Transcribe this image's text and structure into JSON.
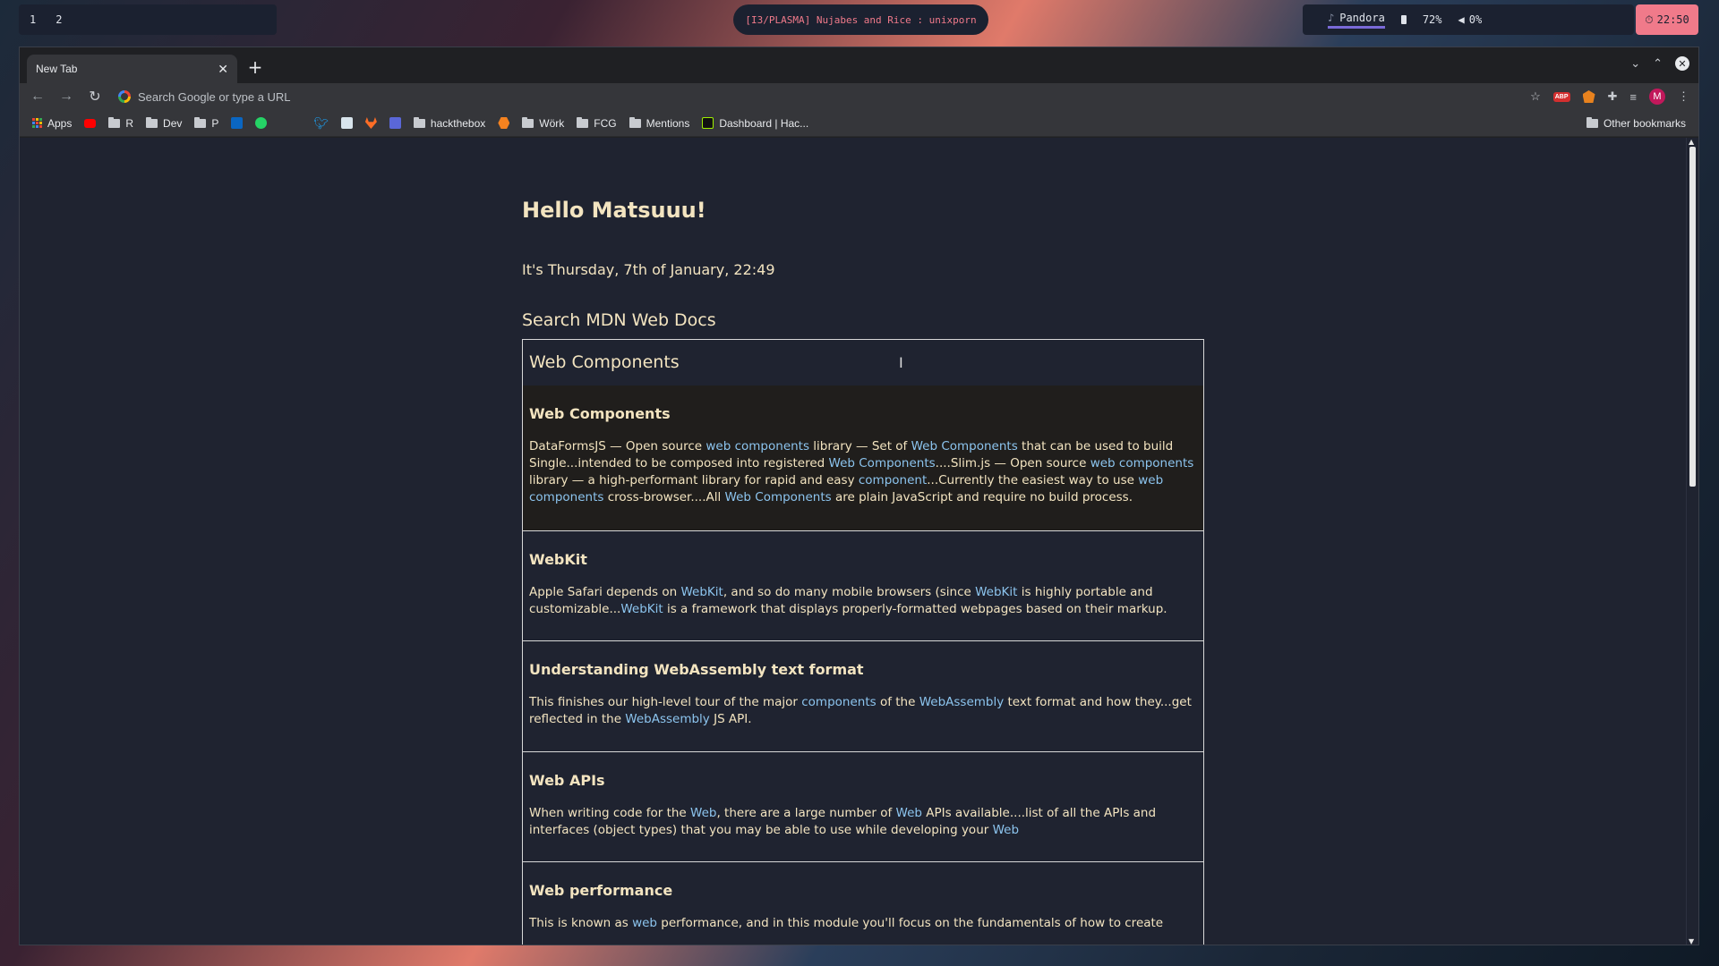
{
  "topbar": {
    "workspaces": [
      "1",
      "2"
    ],
    "window_title": "[I3/PLASMA] Nujabes and Rice : unixporn",
    "music_label": "Pandora",
    "battery": "72%",
    "volume": "0%",
    "clock": "22:50",
    "colors": {
      "bar_bg": "#1b2130",
      "accent": "#f07a8a",
      "music_underline": "#7a6ad8"
    }
  },
  "browser": {
    "tab_label": "New Tab",
    "omnibox_placeholder": "Search Google or type a URL",
    "avatar_letter": "M",
    "bookmarks": [
      {
        "label": "Apps",
        "icon": "apps-grid-icon"
      },
      {
        "label": "",
        "icon": "youtube-icon"
      },
      {
        "label": "R",
        "icon": "folder-icon"
      },
      {
        "label": "Dev",
        "icon": "folder-icon"
      },
      {
        "label": "P",
        "icon": "folder-icon"
      },
      {
        "label": "",
        "icon": "linkedin-icon"
      },
      {
        "label": "",
        "icon": "whatsapp-icon"
      },
      {
        "label": "",
        "icon": "twitter-icon"
      },
      {
        "label": "",
        "icon": "codepen-icon"
      },
      {
        "label": "",
        "icon": "gitlab-icon"
      },
      {
        "label": "",
        "icon": "stackshare-icon"
      },
      {
        "label": "hackthebox",
        "icon": "folder-icon"
      },
      {
        "label": "",
        "icon": "hexagon-icon"
      },
      {
        "label": "Wörk",
        "icon": "folder-icon"
      },
      {
        "label": "FCG",
        "icon": "folder-icon"
      },
      {
        "label": "Mentions",
        "icon": "folder-icon"
      },
      {
        "label": "Dashboard | Hac...",
        "icon": "dashboard-icon"
      }
    ],
    "other_bookmarks": "Other bookmarks"
  },
  "page": {
    "greeting": "Hello Matsuuu!",
    "date": "It's Thursday, 7th of January, 22:49",
    "search_title": "Search MDN Web Docs",
    "search_value": "Web Components",
    "colors": {
      "page_bg": "#1f2330",
      "text": "#f3e4c0",
      "highlight": "#8cc4ee"
    },
    "results": [
      {
        "title": "Web Components",
        "segments": [
          [
            "DataFormsJS — Open source ",
            0
          ],
          [
            "web components",
            1
          ],
          [
            " library — Set of ",
            0
          ],
          [
            "Web Components",
            1
          ],
          [
            " that can be used to build Single...intended to be composed into registered ",
            0
          ],
          [
            "Web Components",
            1
          ],
          [
            "....Slim.js — Open source ",
            0
          ],
          [
            "web components",
            1
          ],
          [
            " library — a high-performant library for rapid and easy ",
            0
          ],
          [
            "component",
            1
          ],
          [
            "...Currently the easiest way to use ",
            0
          ],
          [
            "web components",
            1
          ],
          [
            " cross-browser....All ",
            0
          ],
          [
            "Web Components",
            1
          ],
          [
            " are plain JavaScript and require no build process.",
            0
          ]
        ]
      },
      {
        "title": "WebKit",
        "segments": [
          [
            "Apple Safari depends on ",
            0
          ],
          [
            "WebKit",
            1
          ],
          [
            ", and so do many mobile browsers (since ",
            0
          ],
          [
            "WebKit",
            1
          ],
          [
            " is highly portable and customizable...",
            0
          ],
          [
            "WebKit",
            1
          ],
          [
            " is a framework that displays properly-formatted webpages based on their markup.",
            0
          ]
        ]
      },
      {
        "title": "Understanding WebAssembly text format",
        "segments": [
          [
            "This finishes our high-level tour of the major ",
            0
          ],
          [
            "components",
            1
          ],
          [
            " of the ",
            0
          ],
          [
            "WebAssembly",
            1
          ],
          [
            " text format and how they...get reflected in the ",
            0
          ],
          [
            "WebAssembly",
            1
          ],
          [
            " JS API.",
            0
          ]
        ]
      },
      {
        "title": "Web APIs",
        "segments": [
          [
            "When writing code for the ",
            0
          ],
          [
            "Web",
            1
          ],
          [
            ", there are a large number of ",
            0
          ],
          [
            "Web",
            1
          ],
          [
            " APIs available....list of all the APIs and interfaces (object types) that you may be able to use while developing your ",
            0
          ],
          [
            "Web",
            1
          ]
        ]
      },
      {
        "title": "Web performance",
        "segments": [
          [
            "This is known as ",
            0
          ],
          [
            "web",
            1
          ],
          [
            " performance, and in this module you'll focus on the fundamentals of how to create",
            0
          ]
        ]
      }
    ]
  }
}
